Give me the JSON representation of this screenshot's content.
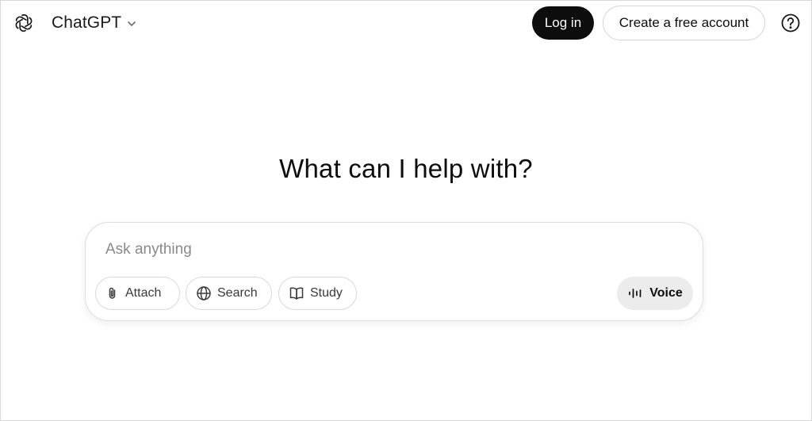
{
  "header": {
    "model_name": "ChatGPT",
    "login_label": "Log in",
    "signup_label": "Create a free account",
    "help_icon": "question-circle-icon"
  },
  "main": {
    "headline": "What can I help with?"
  },
  "composer": {
    "placeholder": "Ask anything",
    "value": "",
    "tools": [
      {
        "label": "Attach",
        "icon": "paperclip-icon"
      },
      {
        "label": "Search",
        "icon": "globe-icon"
      },
      {
        "label": "Study",
        "icon": "book-open-icon"
      }
    ],
    "voice_label": "Voice",
    "voice_icon": "waveform-icon"
  },
  "colors": {
    "primary_button_bg": "#0d0d0d",
    "primary_button_text": "#ffffff",
    "voice_button_bg": "#ececec",
    "border": "#d9d9d9"
  }
}
